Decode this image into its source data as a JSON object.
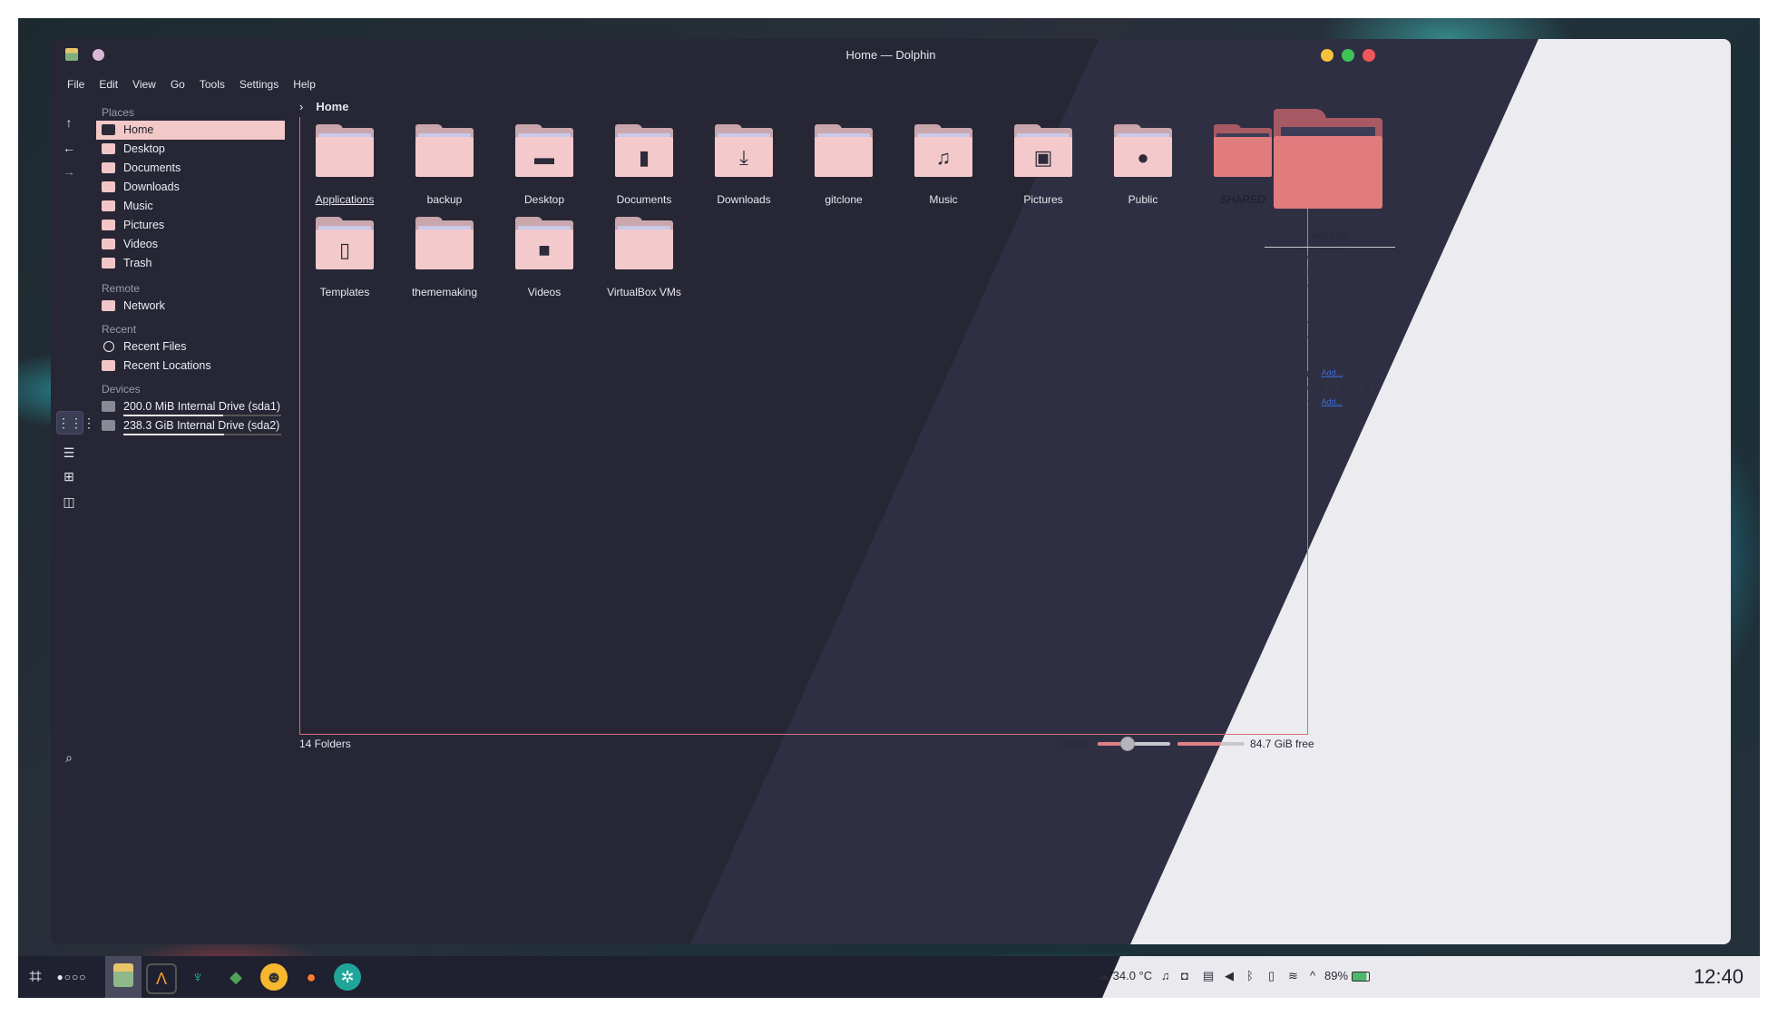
{
  "window": {
    "title": "Home — Dolphin",
    "menu": [
      "File",
      "Edit",
      "View",
      "Go",
      "Tools",
      "Settings",
      "Help"
    ]
  },
  "sidebar": {
    "places_header": "Places",
    "places": [
      {
        "label": "Home",
        "selected": true
      },
      {
        "label": "Desktop"
      },
      {
        "label": "Documents"
      },
      {
        "label": "Downloads"
      },
      {
        "label": "Music"
      },
      {
        "label": "Pictures"
      },
      {
        "label": "Videos"
      },
      {
        "label": "Trash"
      }
    ],
    "remote_header": "Remote",
    "remote": [
      {
        "label": "Network"
      }
    ],
    "recent_header": "Recent",
    "recent": [
      {
        "label": "Recent Files"
      },
      {
        "label": "Recent Locations"
      }
    ],
    "devices_header": "Devices",
    "devices": [
      {
        "label": "200.0 MiB Internal Drive (sda1)",
        "used_fraction": 0.63
      },
      {
        "label": "238.3 GiB Internal Drive (sda2)",
        "used_fraction": 0.64
      }
    ]
  },
  "breadcrumb": {
    "current": "Home"
  },
  "folders": [
    {
      "name": "Applications",
      "icon": "none"
    },
    {
      "name": "backup",
      "icon": "none"
    },
    {
      "name": "Desktop",
      "icon": "desktop"
    },
    {
      "name": "Documents",
      "icon": "document"
    },
    {
      "name": "Downloads",
      "icon": "download"
    },
    {
      "name": "gitclone",
      "icon": "none"
    },
    {
      "name": "Music",
      "icon": "music"
    },
    {
      "name": "Pictures",
      "icon": "picture"
    },
    {
      "name": "Public",
      "icon": "user"
    },
    {
      "name": "SHARED",
      "icon": "none"
    },
    {
      "name": "Templates",
      "icon": "template"
    },
    {
      "name": "thememaking",
      "icon": "none"
    },
    {
      "name": "Videos",
      "icon": "video"
    },
    {
      "name": "VirtualBox VMs",
      "icon": "none"
    }
  ],
  "status": {
    "count": "14 Folders",
    "zoom_label": "Zoom:",
    "zoom_fraction": 0.4,
    "free_label": "84.7 GiB free",
    "used_fraction": 0.65
  },
  "info_panel": {
    "name": "backup",
    "rows": [
      {
        "k": "Type:",
        "v": "folder"
      },
      {
        "k": "Size:",
        "v": "1 item"
      },
      {
        "k": "Modified:",
        "v": "Thursday, 25 August 2022 at 23:27"
      },
      {
        "k": "Accessed:",
        "v": "Yesterday at 20:03"
      },
      {
        "k": "Created:",
        "v": "Thursday, 25 August 2022 at 21:16"
      },
      {
        "k": "Tags:",
        "v": "Add...",
        "link": true
      },
      {
        "k": "Rating:",
        "v": "★★★★★",
        "stars": true
      },
      {
        "k": "Comment:",
        "v": "Add...",
        "link": true
      }
    ]
  },
  "taskbar": {
    "temperature": "34.0 °C",
    "battery": "89%",
    "clock": "12:40"
  },
  "colors": {
    "accent": "#f2c8c8",
    "folder_front": "#f3c9cc",
    "highlight_border": "#d96f77",
    "dark_bg": "#262635",
    "light_bg": "#ebebf0"
  }
}
